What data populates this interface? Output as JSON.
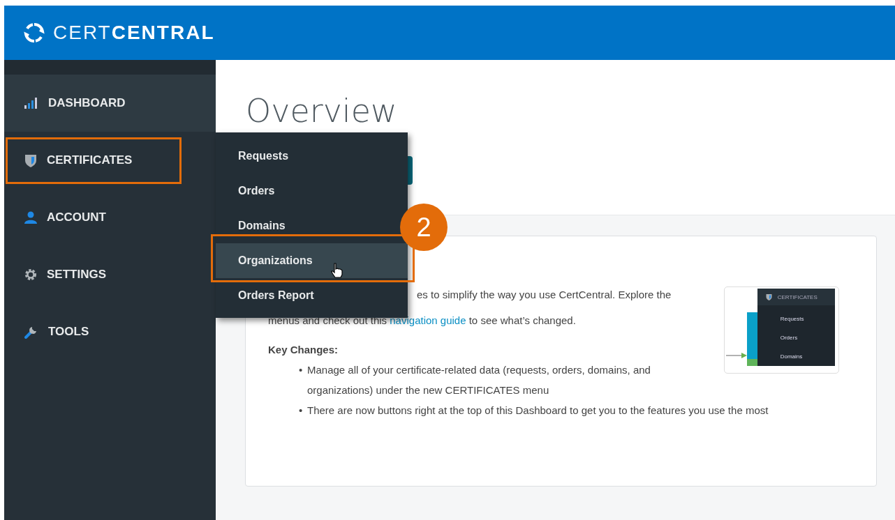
{
  "header": {
    "logo_light": "CERT",
    "logo_bold": "CENTRAL"
  },
  "sidebar": {
    "items": [
      {
        "label": "DASHBOARD",
        "kind": "dashboard",
        "selected": true,
        "highlighted": false
      },
      {
        "label": "CERTIFICATES",
        "kind": "certificates",
        "selected": false,
        "highlighted": true
      },
      {
        "label": "ACCOUNT",
        "kind": "account",
        "selected": false,
        "highlighted": false
      },
      {
        "label": "SETTINGS",
        "kind": "settings",
        "selected": false,
        "highlighted": false
      },
      {
        "label": "TOOLS",
        "kind": "tools",
        "selected": false,
        "highlighted": false
      }
    ]
  },
  "submenu": {
    "items": [
      {
        "label": "Requests",
        "selected": false,
        "highlighted": false
      },
      {
        "label": "Orders",
        "selected": false,
        "highlighted": false
      },
      {
        "label": "Domains",
        "selected": false,
        "highlighted": false
      },
      {
        "label": "Organizations",
        "selected": true,
        "highlighted": true
      },
      {
        "label": "Orders Report",
        "selected": false,
        "highlighted": false
      }
    ]
  },
  "callout": {
    "number": "2"
  },
  "page": {
    "title": "Overview"
  },
  "card": {
    "intro_line": "es to simplify the way you use CertCentral. Explore the",
    "guide_before": "menus and check out this",
    "link": "navigation guide",
    "guide_after": "to see what’s changed.",
    "heading": "Key Changes:",
    "marker": "•",
    "bullets": [
      "Manage all of your certificate-related data (requests, orders, domains, and organizations) under the new CERTIFICATES menu",
      "There are now buttons right at the top of this Dashboard to get you to the features you use the most"
    ],
    "preview": {
      "menu_title": "CERTIFICATES",
      "items": [
        "Requests",
        "Orders",
        "Domains"
      ]
    }
  }
}
